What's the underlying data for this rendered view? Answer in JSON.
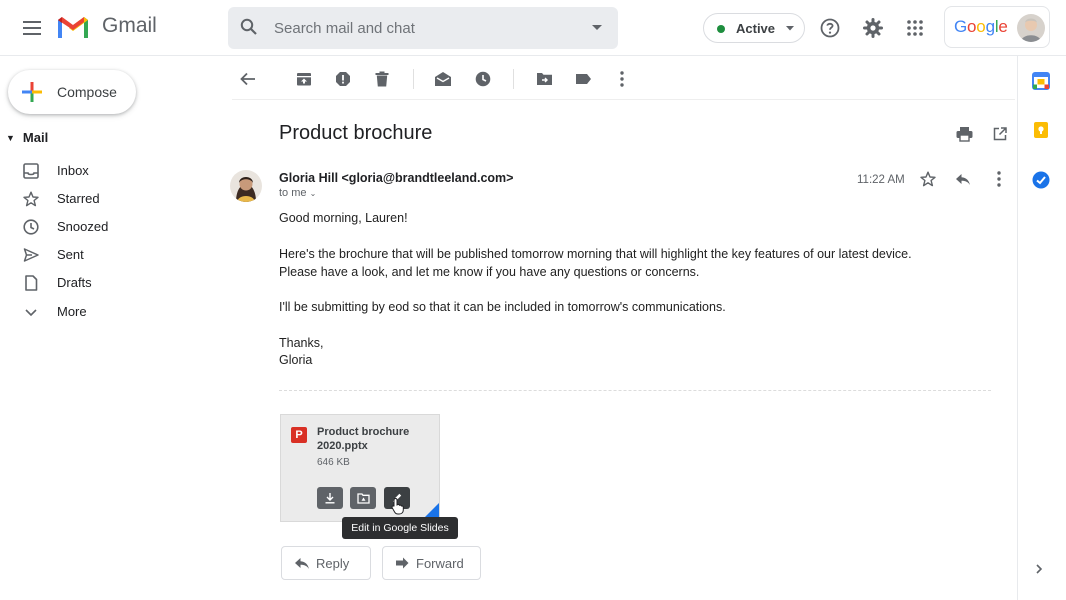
{
  "app": {
    "title": "Gmail"
  },
  "search": {
    "placeholder": "Search mail and chat"
  },
  "status": {
    "label": "Active",
    "color": "#1e8e3e"
  },
  "account": {
    "brand": "Google"
  },
  "compose": {
    "label": "Compose"
  },
  "nav": {
    "section": "Mail",
    "items": [
      {
        "label": "Inbox",
        "icon": "inbox-icon"
      },
      {
        "label": "Starred",
        "icon": "star-icon"
      },
      {
        "label": "Snoozed",
        "icon": "clock-icon"
      },
      {
        "label": "Sent",
        "icon": "send-icon"
      },
      {
        "label": "Drafts",
        "icon": "draft-icon"
      },
      {
        "label": "More",
        "icon": "chevron-down-icon"
      }
    ]
  },
  "message": {
    "subject": "Product brochure",
    "sender": "Gloria Hill <gloria@brandtleeland.com>",
    "recipient": "to me",
    "time": "11:22 AM",
    "body": [
      "Good morning, Lauren!",
      "Here's the brochure that will be published tomorrow morning that will highlight the key features of our latest device.",
      "Please have a look, and let me know if you have any questions or concerns.",
      "I'll be submitting by eod so that it can be included in tomorrow's communications.",
      "Thanks,",
      "Gloria"
    ]
  },
  "attachment": {
    "type_badge": "P",
    "name_line1": "Product brochure",
    "name_line2": "2020.pptx",
    "size": "646 KB",
    "tooltip": "Edit in Google Slides"
  },
  "actions": {
    "reply": "Reply",
    "forward": "Forward"
  },
  "colors": {
    "gmail_red": "#ea4335",
    "google_blue": "#4285f4",
    "accent": "#1a73e8"
  }
}
